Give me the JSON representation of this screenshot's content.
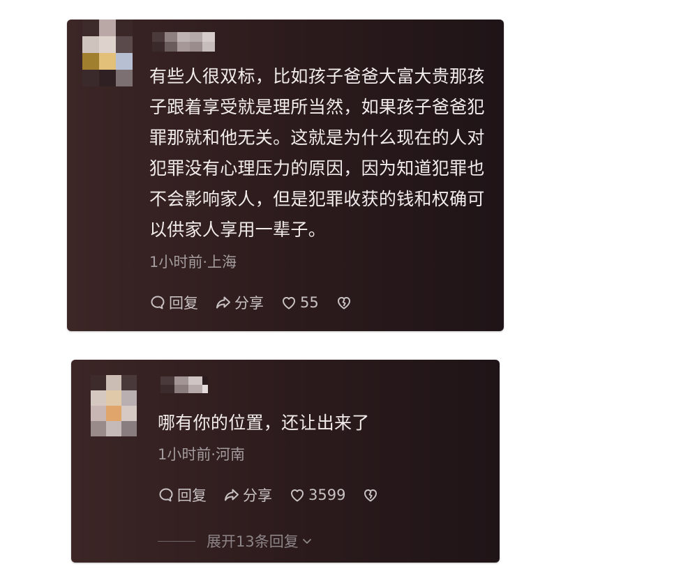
{
  "comments": [
    {
      "text": "有些人很双标，比如孩子爸爸大富大贵那孩子跟着享受就是理所当然，如果孩子爸爸犯罪那就和他无关。这就是为什么现在的人对犯罪没有心理压力的原因，因为知道犯罪也不会影响家人，但是犯罪收获的钱和权确可以供家人享用一辈子。",
      "meta": "1小时前·上海",
      "reply_label": "回复",
      "share_label": "分享",
      "like_count": "55"
    },
    {
      "text": "哪有你的位置，还让出来了",
      "meta": "1小时前·河南",
      "reply_label": "回复",
      "share_label": "分享",
      "like_count": "3599",
      "expand_label": "展开13条回复"
    }
  ],
  "icons": {
    "reply": "comment-bubble-icon",
    "share": "share-arrow-icon",
    "like": "heart-icon",
    "dislike": "broken-heart-icon",
    "expand": "chevron-down-icon"
  },
  "colors": {
    "card_bg": "#2e1c1e",
    "text": "#f2ecec",
    "meta": "#a49c9f"
  }
}
